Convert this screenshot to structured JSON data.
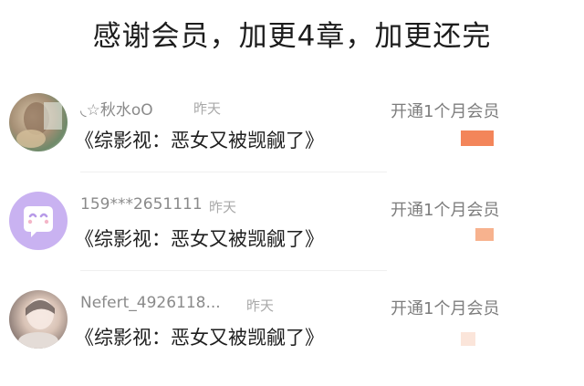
{
  "headline": "感谢会员，加更4章，加更还完",
  "entries": [
    {
      "username": "◟☆秋水oO",
      "time": "昨天",
      "book": "《综影视：恶女又被觊觎了》",
      "status": "开通1个月会员",
      "avatar_icon": "photo-avatar",
      "swatch_color": "#f3855a"
    },
    {
      "username": "159***2651111",
      "time": "昨天",
      "book": "《综影视：恶女又被觊觎了》",
      "status": "开通1个月会员",
      "avatar_icon": "smiley-mascot-icon",
      "swatch_color": "#f7b28e"
    },
    {
      "username": "Nefert_4926118...",
      "time": "昨天",
      "book": "《综影视：恶女又被觊觎了》",
      "status": "开通1个月会员",
      "avatar_icon": "photo-avatar",
      "swatch_color": "#fbe5da"
    }
  ]
}
